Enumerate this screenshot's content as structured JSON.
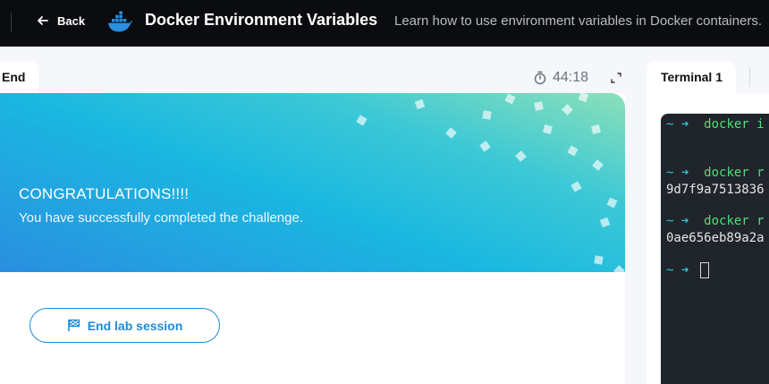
{
  "header": {
    "back_label": "Back",
    "title": "Docker Environment Variables",
    "subtitle": "Learn how to use environment variables in Docker containers."
  },
  "left_panel": {
    "tab_label": "End",
    "timer": "44:18",
    "banner": {
      "heading": "CONGRATULATIONS!!!!",
      "message": "You have successfully completed the challenge."
    },
    "end_button_label": "End lab session"
  },
  "right_panel": {
    "tab_label": "Terminal 1",
    "terminal": {
      "prompt": "~ ➜",
      "lines": [
        {
          "cmd": "docker i"
        },
        {
          "cmd": "docker r",
          "output": "9d7f9a7513836"
        },
        {
          "cmd": "docker r",
          "output": "0ae656eb89a2a"
        }
      ]
    }
  },
  "colors": {
    "accent": "#1d8ad6",
    "header_bg": "#0b0c0f",
    "terminal_bg": "#20242b",
    "prompt": "#35c4e0",
    "command": "#4ee07a"
  }
}
